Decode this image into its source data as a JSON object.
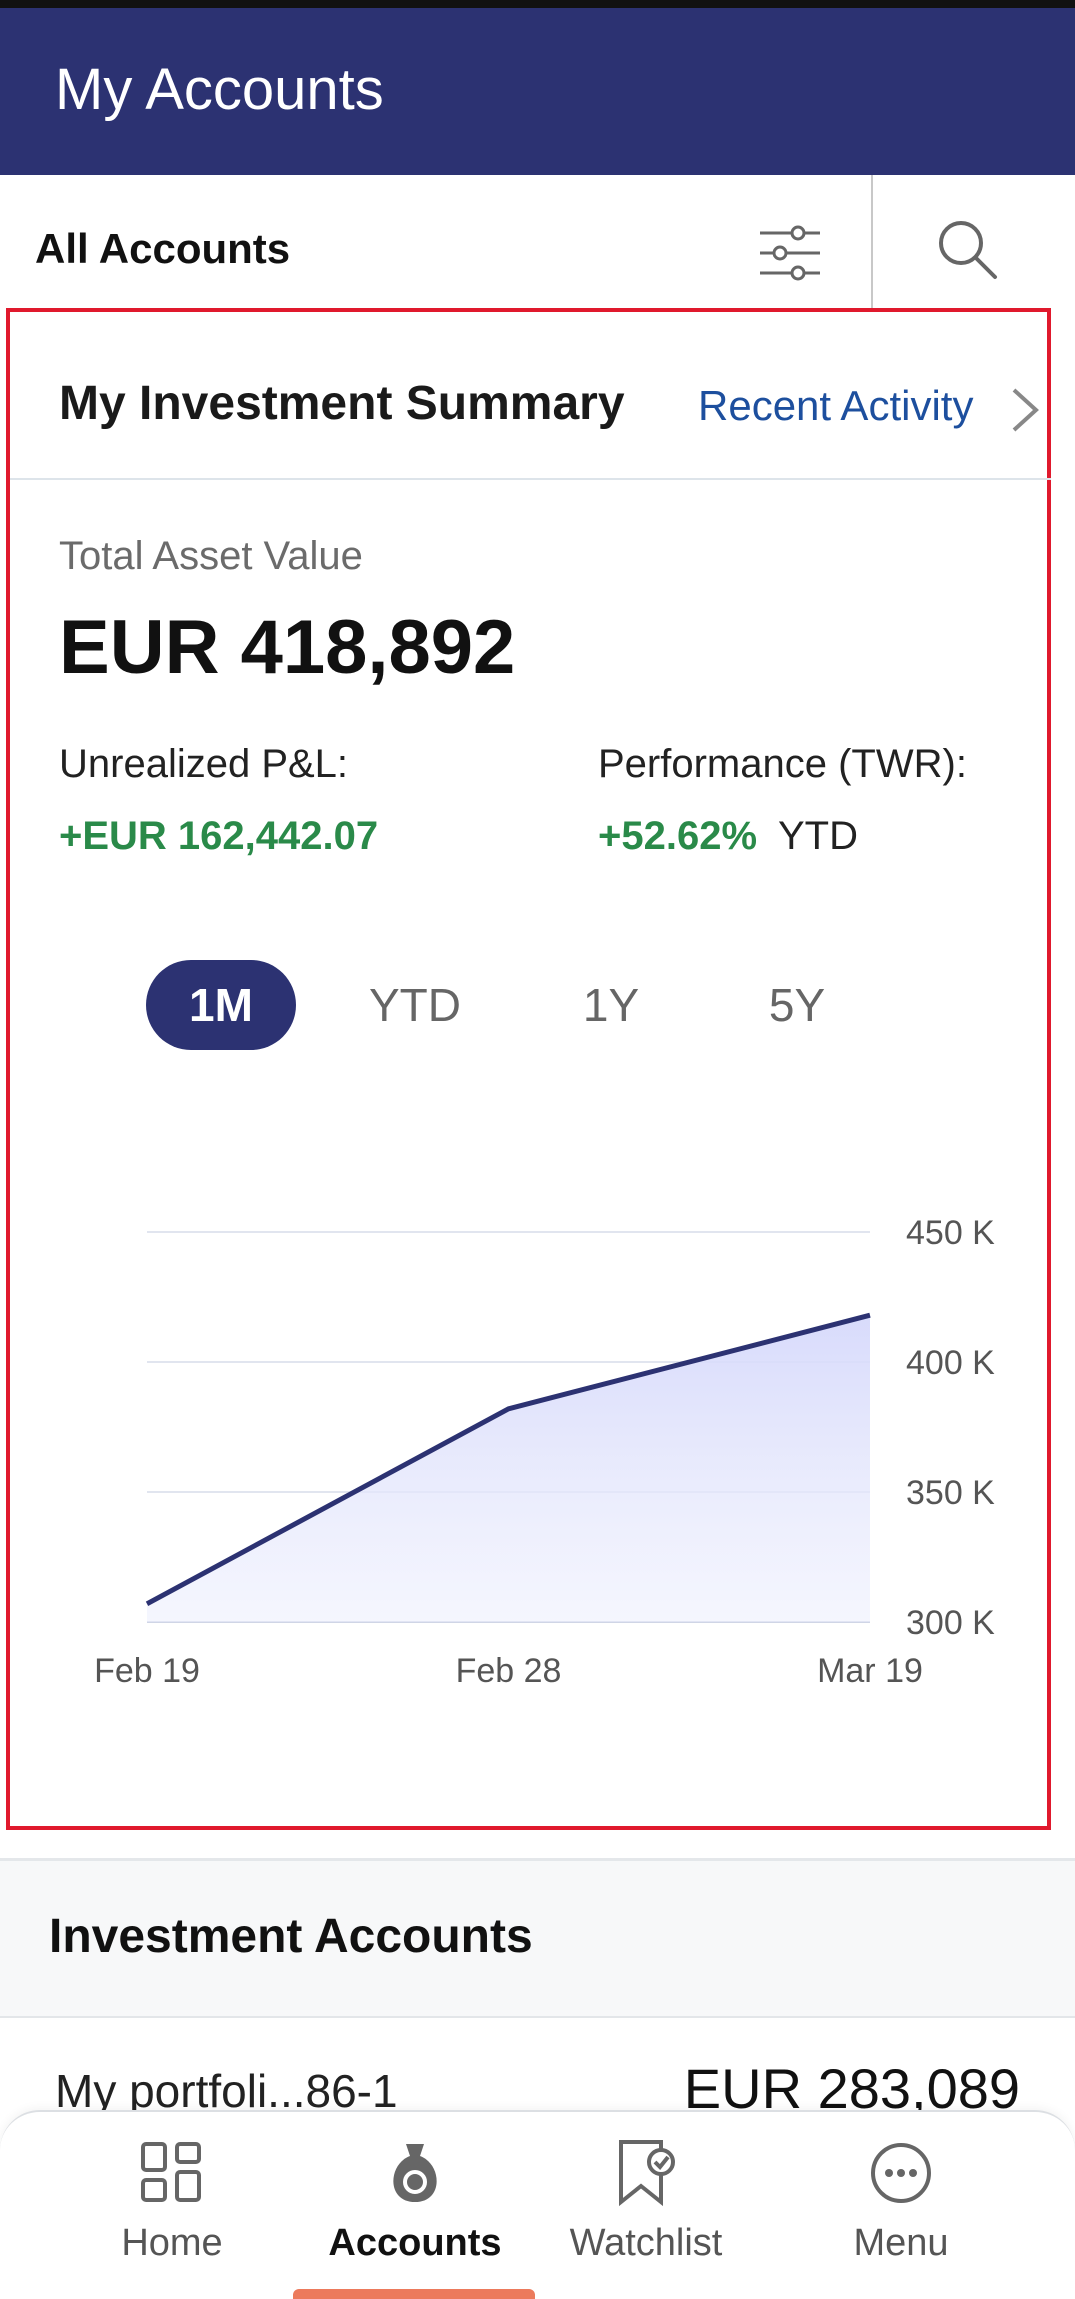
{
  "header": {
    "title": "My Accounts"
  },
  "filter_bar": {
    "label": "All Accounts",
    "filter_icon": "sliders-icon",
    "search_icon": "search-icon"
  },
  "summary": {
    "title": "My Investment Summary",
    "recent_activity": "Recent Activity",
    "total_asset_label": "Total Asset Value",
    "total_asset_value": "EUR 418,892",
    "unrealized_label": "Unrealized P&L:",
    "unrealized_value": "+EUR 162,442.07",
    "performance_label": "Performance (TWR):",
    "performance_value": "+52.62%",
    "performance_suffix": "YTD",
    "tabs": [
      {
        "label": "1M",
        "active": true
      },
      {
        "label": "YTD",
        "active": false
      },
      {
        "label": "1Y",
        "active": false
      },
      {
        "label": "5Y",
        "active": false
      }
    ],
    "colors": {
      "accent": "#2c3272",
      "positive": "#2a8a49",
      "link": "#1d4f9e",
      "highlight_border": "#e0192d"
    }
  },
  "chart_data": {
    "type": "area",
    "x": [
      "Feb 19",
      "Feb 28",
      "Mar 19"
    ],
    "values": [
      307,
      382,
      418
    ],
    "xlabel": "",
    "ylabel": "",
    "ylim": [
      300,
      450
    ],
    "y_ticks": [
      450,
      400,
      350,
      300
    ],
    "y_tick_labels": [
      "450 K",
      "400 K",
      "350 K",
      "300 K"
    ],
    "grid": true,
    "line_color": "#2c3272",
    "fill_color": "#d6d9fb"
  },
  "investment_accounts": {
    "title": "Investment Accounts",
    "rows": [
      {
        "name": "My portfoli...86-1",
        "value": "EUR 283,089"
      }
    ]
  },
  "bottom_nav": {
    "items": [
      {
        "label": "Home",
        "icon": "grid-icon",
        "active": false
      },
      {
        "label": "Accounts",
        "icon": "money-bag-icon",
        "active": true
      },
      {
        "label": "Watchlist",
        "icon": "bookmark-check-icon",
        "active": false
      },
      {
        "label": "Menu",
        "icon": "more-dots-icon",
        "active": false
      }
    ]
  }
}
